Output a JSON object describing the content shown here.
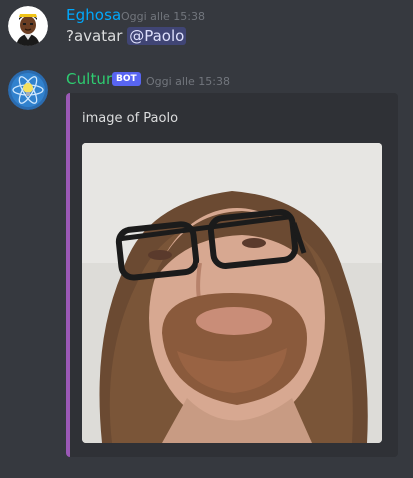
{
  "messages": [
    {
      "username": "Eghosa",
      "username_color": "#00a8fc",
      "timestamp": "Oggi alle 15:38",
      "content_prefix": "?avatar ",
      "mention": "@Paolo"
    },
    {
      "username": "Cultur",
      "username_color": "#2ecc71",
      "bot_tag": "BOT",
      "timestamp": "Oggi alle 15:38",
      "embed": {
        "accent_color": "#9b59b6",
        "description": "image of Paolo",
        "image_icon": "avatar-photo"
      }
    }
  ]
}
